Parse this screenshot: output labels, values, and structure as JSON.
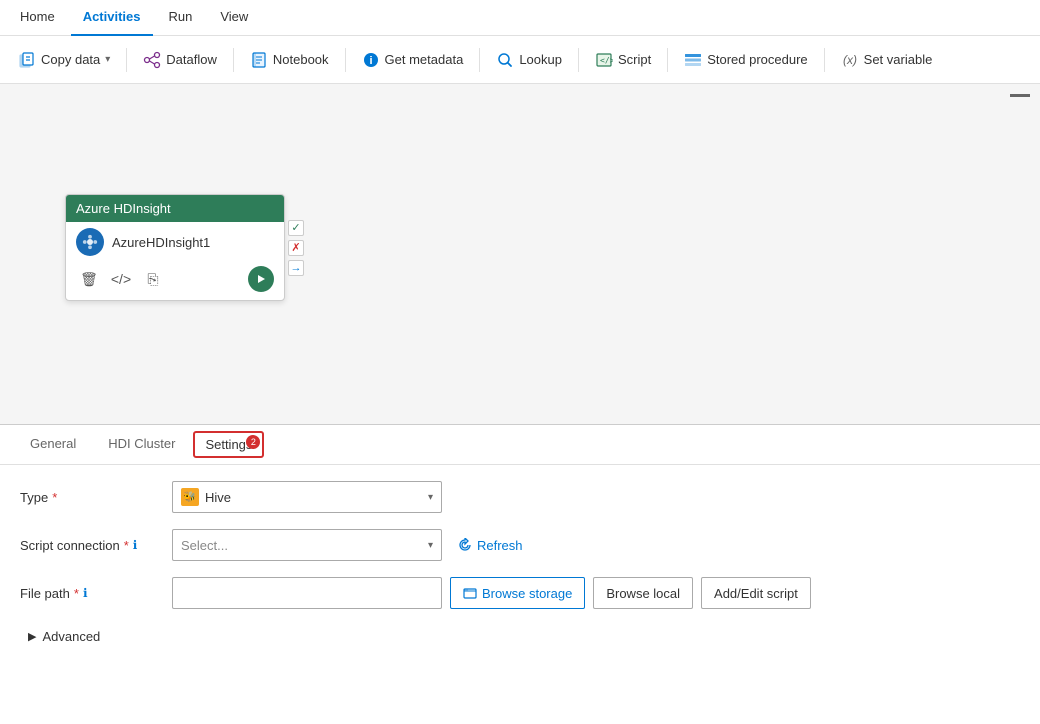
{
  "nav": {
    "items": [
      {
        "label": "Home",
        "active": false
      },
      {
        "label": "Activities",
        "active": true
      },
      {
        "label": "Run",
        "active": false
      },
      {
        "label": "View",
        "active": false
      }
    ]
  },
  "toolbar": {
    "buttons": [
      {
        "id": "copy-data",
        "label": "Copy data",
        "dropdown": true,
        "icon": "copy"
      },
      {
        "id": "dataflow",
        "label": "Dataflow",
        "dropdown": false,
        "icon": "dataflow"
      },
      {
        "id": "notebook",
        "label": "Notebook",
        "dropdown": false,
        "icon": "notebook"
      },
      {
        "id": "get-metadata",
        "label": "Get metadata",
        "dropdown": false,
        "icon": "info"
      },
      {
        "id": "lookup",
        "label": "Lookup",
        "dropdown": false,
        "icon": "lookup"
      },
      {
        "id": "script",
        "label": "Script",
        "dropdown": false,
        "icon": "script"
      },
      {
        "id": "stored-procedure",
        "label": "Stored procedure",
        "dropdown": false,
        "icon": "stored-proc"
      },
      {
        "id": "set-variable",
        "label": "Set variable",
        "dropdown": false,
        "icon": "set-var"
      }
    ]
  },
  "canvas": {
    "node": {
      "title": "Azure HDInsight",
      "name": "AzureHDInsight1"
    }
  },
  "bottomPanel": {
    "tabs": [
      {
        "id": "general",
        "label": "General",
        "active": false
      },
      {
        "id": "hdi-cluster",
        "label": "HDI Cluster",
        "active": false
      },
      {
        "id": "settings",
        "label": "Settings",
        "active": true,
        "badge": "2",
        "highlighted": true
      }
    ],
    "settings": {
      "typeLabel": "Type",
      "typeValue": "Hive",
      "scriptConnectionLabel": "Script connection",
      "scriptConnectionPlaceholder": "Select...",
      "filePathLabel": "File path",
      "refreshLabel": "Refresh",
      "browseStorageLabel": "Browse storage",
      "browseLocalLabel": "Browse local",
      "addEditScriptLabel": "Add/Edit script",
      "advancedLabel": "Advanced"
    }
  }
}
